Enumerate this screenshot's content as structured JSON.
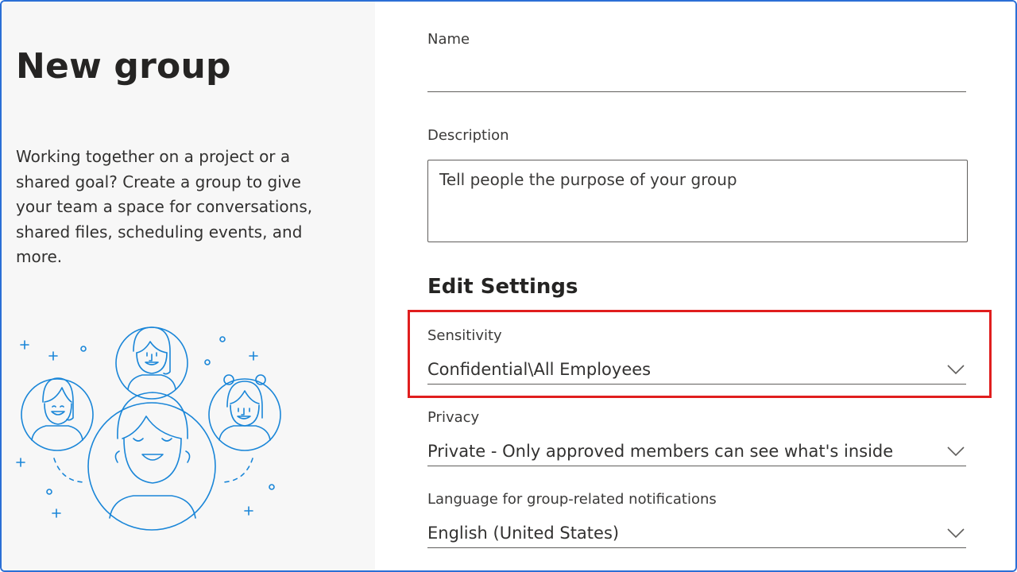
{
  "left": {
    "title": "New group",
    "intro": "Working together on a project or a shared goal? Create a group to give your team a space for conversations, shared files, scheduling events, and more."
  },
  "form": {
    "name_label": "Name",
    "name_value": "",
    "description_label": "Description",
    "description_placeholder": "Tell people the purpose of your group",
    "settings_title": "Edit Settings",
    "sensitivity": {
      "label": "Sensitivity",
      "value": "Confidential\\All Employees"
    },
    "privacy": {
      "label": "Privacy",
      "value": "Private - Only approved members can see what's inside"
    },
    "language": {
      "label": "Language for group-related notifications",
      "value": "English (United States)"
    }
  },
  "colors": {
    "accent_blue": "#2b6fd6",
    "highlight_red": "#e01e1e",
    "illustration_blue": "#1a86d8"
  },
  "icons": {
    "dropdown": "chevron-down-icon",
    "illustration": "people-group-illustration"
  }
}
